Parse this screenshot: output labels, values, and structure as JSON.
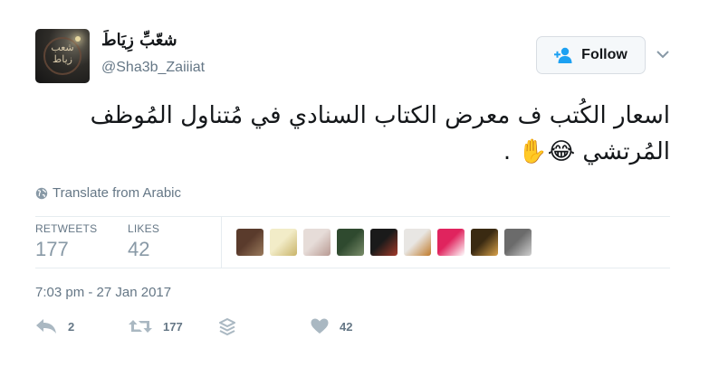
{
  "author": {
    "display_name": "شعّبِّ زِيَاطَ",
    "handle": "@Sha3b_Zaiiiat",
    "avatar_text": "شعب زياط"
  },
  "follow_button": {
    "label": "Follow"
  },
  "tweet": {
    "text": "اسعار الكُتب ف معرض الكتاب السنادي في مُتناول المُوظف المُرتشي 😂✋ ."
  },
  "translate_link": "Translate from Arabic",
  "stats": {
    "retweets_label": "RETWEETS",
    "retweets_count": "177",
    "likes_label": "LIKES",
    "likes_count": "42"
  },
  "likers": [
    {
      "name": "liker-avatar-1",
      "colors": [
        "#5a3b2c",
        "#9a7a5c"
      ]
    },
    {
      "name": "liker-avatar-2",
      "colors": [
        "#f2ecc8",
        "#c9b46a"
      ]
    },
    {
      "name": "liker-avatar-3",
      "colors": [
        "#e6dcd8",
        "#b89a93"
      ]
    },
    {
      "name": "liker-avatar-4",
      "colors": [
        "#2f4a2f",
        "#7a8d6a"
      ]
    },
    {
      "name": "liker-avatar-5",
      "colors": [
        "#1a1a1a",
        "#a33a2a"
      ]
    },
    {
      "name": "liker-avatar-6",
      "colors": [
        "#e8e6e3",
        "#c07a2a"
      ]
    },
    {
      "name": "liker-avatar-7",
      "colors": [
        "#e0245e",
        "#ffffff"
      ]
    },
    {
      "name": "liker-avatar-8",
      "colors": [
        "#3a2a12",
        "#d9a24a"
      ]
    },
    {
      "name": "liker-avatar-9",
      "colors": [
        "#6b6b6b",
        "#cfcfcf"
      ]
    }
  ],
  "timestamp": "7:03 pm - 27 Jan 2017",
  "actions": {
    "reply_count": "2",
    "retweet_count": "177",
    "like_count": "42"
  },
  "colors": {
    "text_secondary": "#657786",
    "icon_gray": "#aab8c2",
    "follow_icon": "#1da1f2"
  }
}
